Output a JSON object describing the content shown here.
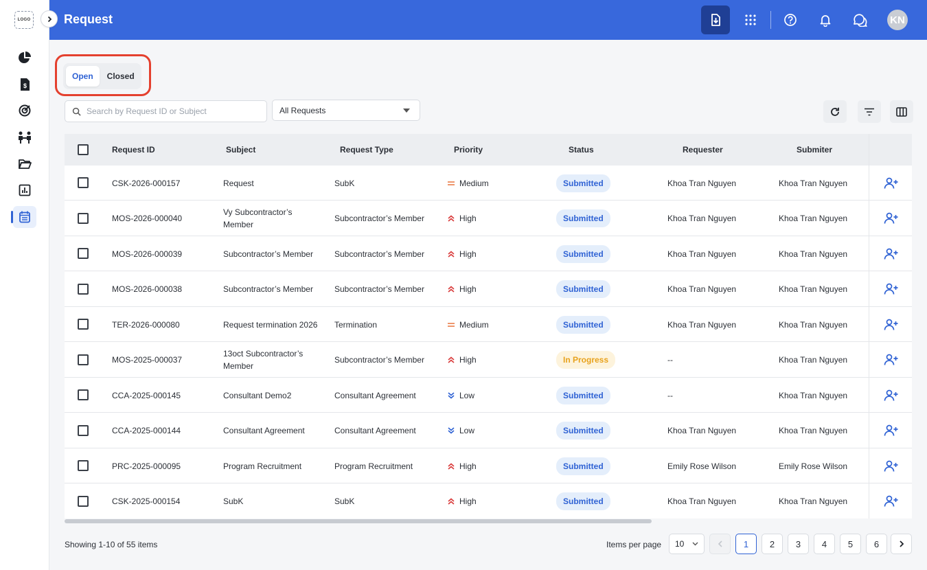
{
  "app": {
    "logo_text": "LOGO",
    "title": "Request",
    "avatar_initials": "KN"
  },
  "icons": {
    "header": [
      "download-icon",
      "apps-grid-icon",
      "help-icon",
      "bell-icon",
      "chat-icon"
    ],
    "sidebar": [
      "pie-chart-icon",
      "invoice-icon",
      "target-icon",
      "people-icon",
      "folder-icon",
      "report-chart-icon",
      "calendar-list-icon"
    ]
  },
  "colors": {
    "header_bg": "#3868dc",
    "accent": "#2f62d4",
    "in_progress": "#e8a21c",
    "tab_highlight": "#e4402e"
  },
  "tabs": [
    {
      "label": "Open",
      "active": true
    },
    {
      "label": "Closed",
      "active": false
    }
  ],
  "toolbar": {
    "search_placeholder": "Search by Request ID or Subject",
    "filter_value": "All Requests"
  },
  "table": {
    "columns": [
      "Request ID",
      "Subject",
      "Request Type",
      "Priority",
      "Status",
      "Requester",
      "Submiter"
    ],
    "rows": [
      {
        "id": "CSK-2026-000157",
        "subject": "Request",
        "type": "SubK",
        "priority": "Medium",
        "status": "Submitted",
        "requester": "Khoa Tran Nguyen",
        "submitter": "Khoa Tran Nguyen"
      },
      {
        "id": "MOS-2026-000040",
        "subject": "Vy Subcontractor’s Member",
        "type": "Subcontractor’s Member",
        "priority": "High",
        "status": "Submitted",
        "requester": "Khoa Tran Nguyen",
        "submitter": "Khoa Tran Nguyen"
      },
      {
        "id": "MOS-2026-000039",
        "subject": "Subcontractor’s Member",
        "type": "Subcontractor’s Member",
        "priority": "High",
        "status": "Submitted",
        "requester": "Khoa Tran Nguyen",
        "submitter": "Khoa Tran Nguyen"
      },
      {
        "id": "MOS-2026-000038",
        "subject": "Subcontractor’s Member",
        "type": "Subcontractor’s Member",
        "priority": "High",
        "status": "Submitted",
        "requester": "Khoa Tran Nguyen",
        "submitter": "Khoa Tran Nguyen"
      },
      {
        "id": "TER-2026-000080",
        "subject": "Request termination 2026",
        "type": "Termination",
        "priority": "Medium",
        "status": "Submitted",
        "requester": "Khoa Tran Nguyen",
        "submitter": "Khoa Tran Nguyen"
      },
      {
        "id": "MOS-2025-000037",
        "subject": "13oct Subcontractor’s Member",
        "type": "Subcontractor’s Member",
        "priority": "High",
        "status": "In Progress",
        "requester": "--",
        "submitter": "Khoa Tran Nguyen"
      },
      {
        "id": "CCA-2025-000145",
        "subject": "Consultant Demo2",
        "type": "Consultant Agreement",
        "priority": "Low",
        "status": "Submitted",
        "requester": "--",
        "submitter": "Khoa Tran Nguyen"
      },
      {
        "id": "CCA-2025-000144",
        "subject": "Consultant Agreement",
        "type": "Consultant Agreement",
        "priority": "Low",
        "status": "Submitted",
        "requester": "Khoa Tran Nguyen",
        "submitter": "Khoa Tran Nguyen"
      },
      {
        "id": "PRC-2025-000095",
        "subject": "Program Recruitment",
        "type": "Program Recruitment",
        "priority": "High",
        "status": "Submitted",
        "requester": "Emily Rose Wilson",
        "submitter": "Emily Rose Wilson"
      },
      {
        "id": "CSK-2025-000154",
        "subject": "SubK",
        "type": "SubK",
        "priority": "High",
        "status": "Submitted",
        "requester": "Khoa Tran Nguyen",
        "submitter": "Khoa Tran Nguyen"
      }
    ]
  },
  "footer": {
    "showing_text": "Showing 1-10 of 55 items",
    "items_per_page_label": "Items per page",
    "items_per_page_value": "10",
    "pages": [
      "1",
      "2",
      "3",
      "4",
      "5",
      "6"
    ],
    "current_page": "1"
  }
}
